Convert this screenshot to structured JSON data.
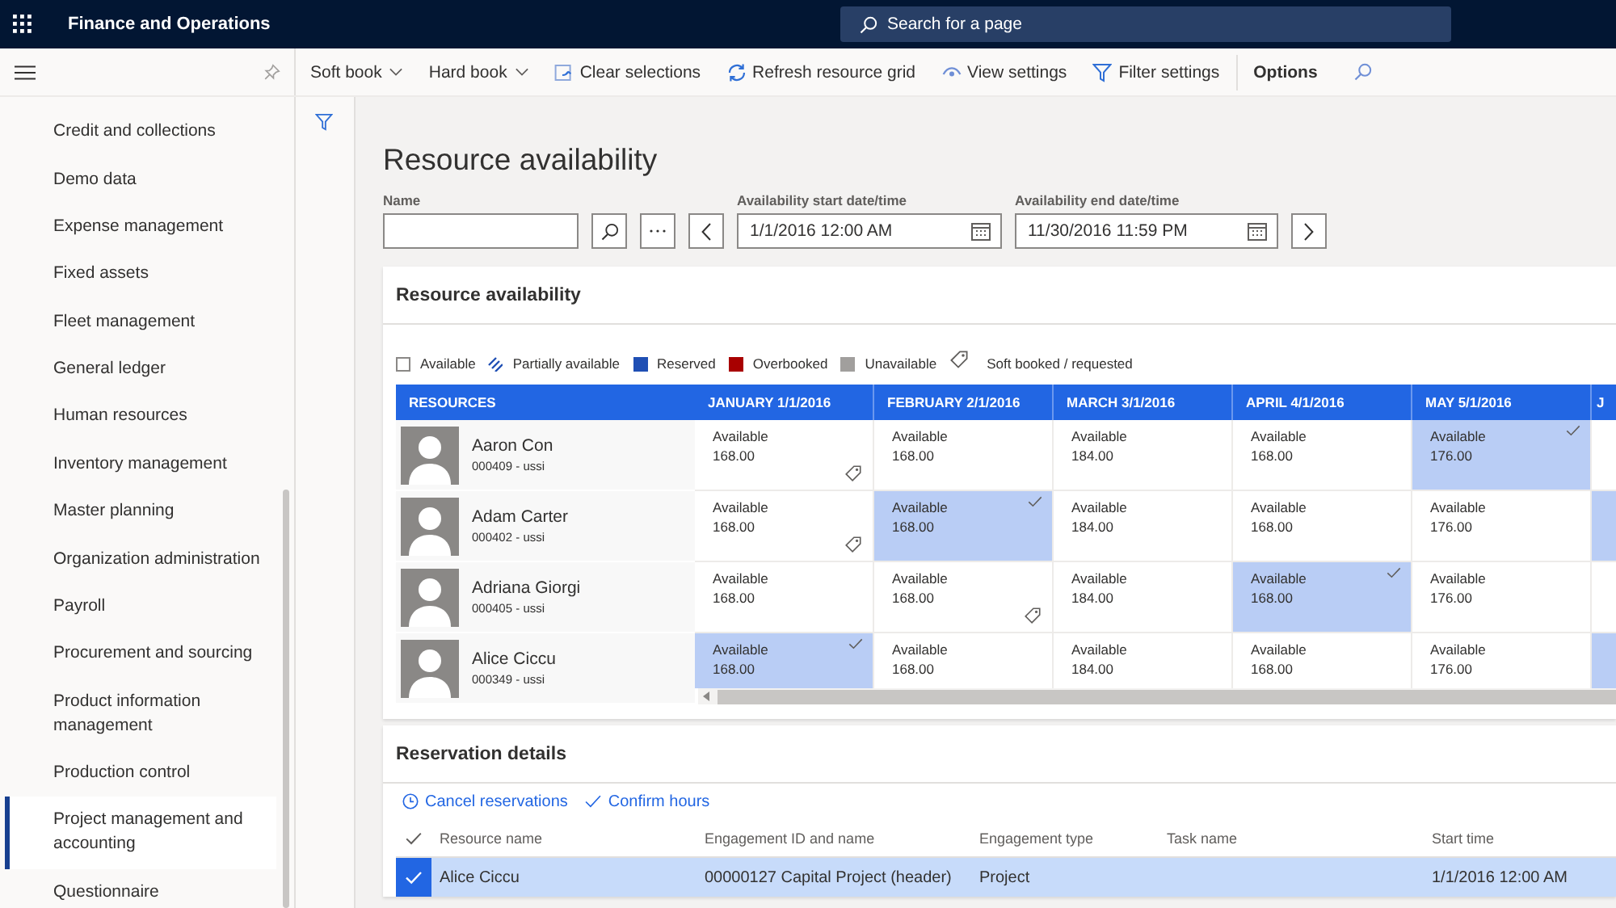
{
  "app_bar": {
    "title": "Finance and Operations",
    "search": {
      "placeholder": "Search for a page"
    }
  },
  "toolbar": {
    "items": [
      {
        "kind": "menu",
        "label": "Soft book"
      },
      {
        "kind": "menu",
        "label": "Hard book"
      },
      {
        "kind": "clear",
        "label": "Clear selections"
      },
      {
        "kind": "refresh",
        "label": "Refresh resource grid"
      },
      {
        "kind": "view",
        "label": "View settings"
      },
      {
        "kind": "filter",
        "label": "Filter settings"
      },
      {
        "kind": "options",
        "label": "Options"
      },
      {
        "kind": "search"
      }
    ]
  },
  "sidebar": {
    "items": [
      {
        "label": "Credit and collections",
        "selected": false
      },
      {
        "label": "Demo data",
        "selected": false
      },
      {
        "label": "Expense management",
        "selected": false
      },
      {
        "label": "Fixed assets",
        "selected": false
      },
      {
        "label": "Fleet management",
        "selected": false
      },
      {
        "label": "General ledger",
        "selected": false
      },
      {
        "label": "Human resources",
        "selected": false
      },
      {
        "label": "Inventory management",
        "selected": false
      },
      {
        "label": "Master planning",
        "selected": false
      },
      {
        "label": "Organization administration",
        "selected": false
      },
      {
        "label": "Payroll",
        "selected": false
      },
      {
        "label": "Procurement and sourcing",
        "selected": false
      },
      {
        "label": "Product information management",
        "selected": false
      },
      {
        "label": "Production control",
        "selected": false
      },
      {
        "label": "Project management and accounting",
        "selected": true
      },
      {
        "label": "Questionnaire",
        "selected": false
      }
    ]
  },
  "page": {
    "title": "Resource availability"
  },
  "filters": {
    "name": {
      "label": "Name"
    },
    "start": {
      "label": "Availability start date/time",
      "value": "1/1/2016 12:00 AM"
    },
    "end": {
      "label": "Availability end date/time",
      "value": "11/30/2016 11:59 PM"
    }
  },
  "availability": {
    "title": "Resource availability",
    "legend": [
      {
        "kind": "outline",
        "label": "Available"
      },
      {
        "kind": "hatched",
        "label": "Partially available"
      },
      {
        "kind": "swatch",
        "color": "#1f4fb4",
        "label": "Reserved"
      },
      {
        "kind": "swatch",
        "color": "#a80000",
        "label": "Overbooked"
      },
      {
        "kind": "swatch",
        "color": "#a19f9d",
        "label": "Unavailable"
      },
      {
        "kind": "tag",
        "label": "Soft booked / requested"
      }
    ],
    "resource_column": "RESOURCES",
    "columns": [
      "JANUARY 1/1/2016",
      "FEBRUARY 2/1/2016",
      "MARCH 3/1/2016",
      "APRIL 4/1/2016",
      "MAY 5/1/2016",
      "J"
    ],
    "rows": [
      {
        "name": "Aaron Con",
        "id": "000409 - ussi",
        "cells": [
          {
            "status": "Available",
            "hours": "168.00",
            "selected": false,
            "soft_booked": true
          },
          {
            "status": "Available",
            "hours": "168.00",
            "selected": false,
            "soft_booked": false
          },
          {
            "status": "Available",
            "hours": "184.00",
            "selected": false,
            "soft_booked": false
          },
          {
            "status": "Available",
            "hours": "168.00",
            "selected": false,
            "soft_booked": false
          },
          {
            "status": "Available",
            "hours": "176.00",
            "selected": true,
            "soft_booked": false
          },
          {
            "selected": false
          }
        ]
      },
      {
        "name": "Adam Carter",
        "id": "000402 - ussi",
        "cells": [
          {
            "status": "Available",
            "hours": "168.00",
            "selected": false,
            "soft_booked": true
          },
          {
            "status": "Available",
            "hours": "168.00",
            "selected": true,
            "soft_booked": false
          },
          {
            "status": "Available",
            "hours": "184.00",
            "selected": false,
            "soft_booked": false
          },
          {
            "status": "Available",
            "hours": "168.00",
            "selected": false,
            "soft_booked": false
          },
          {
            "status": "Available",
            "hours": "176.00",
            "selected": false,
            "soft_booked": false
          },
          {
            "selected": true
          }
        ]
      },
      {
        "name": "Adriana Giorgi",
        "id": "000405 - ussi",
        "cells": [
          {
            "status": "Available",
            "hours": "168.00",
            "selected": false,
            "soft_booked": false
          },
          {
            "status": "Available",
            "hours": "168.00",
            "selected": false,
            "soft_booked": true
          },
          {
            "status": "Available",
            "hours": "184.00",
            "selected": false,
            "soft_booked": false
          },
          {
            "status": "Available",
            "hours": "168.00",
            "selected": true,
            "soft_booked": false
          },
          {
            "status": "Available",
            "hours": "176.00",
            "selected": false,
            "soft_booked": false
          },
          {
            "selected": false
          }
        ]
      },
      {
        "name": "Alice Ciccu",
        "id": "000349 - ussi",
        "cells": [
          {
            "status": "Available",
            "hours": "168.00",
            "selected": true,
            "soft_booked": false
          },
          {
            "status": "Available",
            "hours": "168.00",
            "selected": false,
            "soft_booked": false
          },
          {
            "status": "Available",
            "hours": "184.00",
            "selected": false,
            "soft_booked": false
          },
          {
            "status": "Available",
            "hours": "168.00",
            "selected": false,
            "soft_booked": false
          },
          {
            "status": "Available",
            "hours": "176.00",
            "selected": false,
            "soft_booked": false
          },
          {
            "selected": true
          }
        ]
      }
    ]
  },
  "reservations": {
    "title": "Reservation details",
    "actions": [
      {
        "kind": "cancel",
        "label": "Cancel reservations"
      },
      {
        "kind": "confirm",
        "label": "Confirm hours"
      }
    ],
    "columns": [
      "Resource name",
      "Engagement ID and name",
      "Engagement type",
      "Task name",
      "Start time"
    ],
    "rows": [
      {
        "selected": true,
        "resource_name": "Alice Ciccu",
        "engagement": "00000127 Capital Project (header)",
        "engagement_type": "Project",
        "start_time": "1/1/2016 12:00 AM"
      }
    ]
  }
}
